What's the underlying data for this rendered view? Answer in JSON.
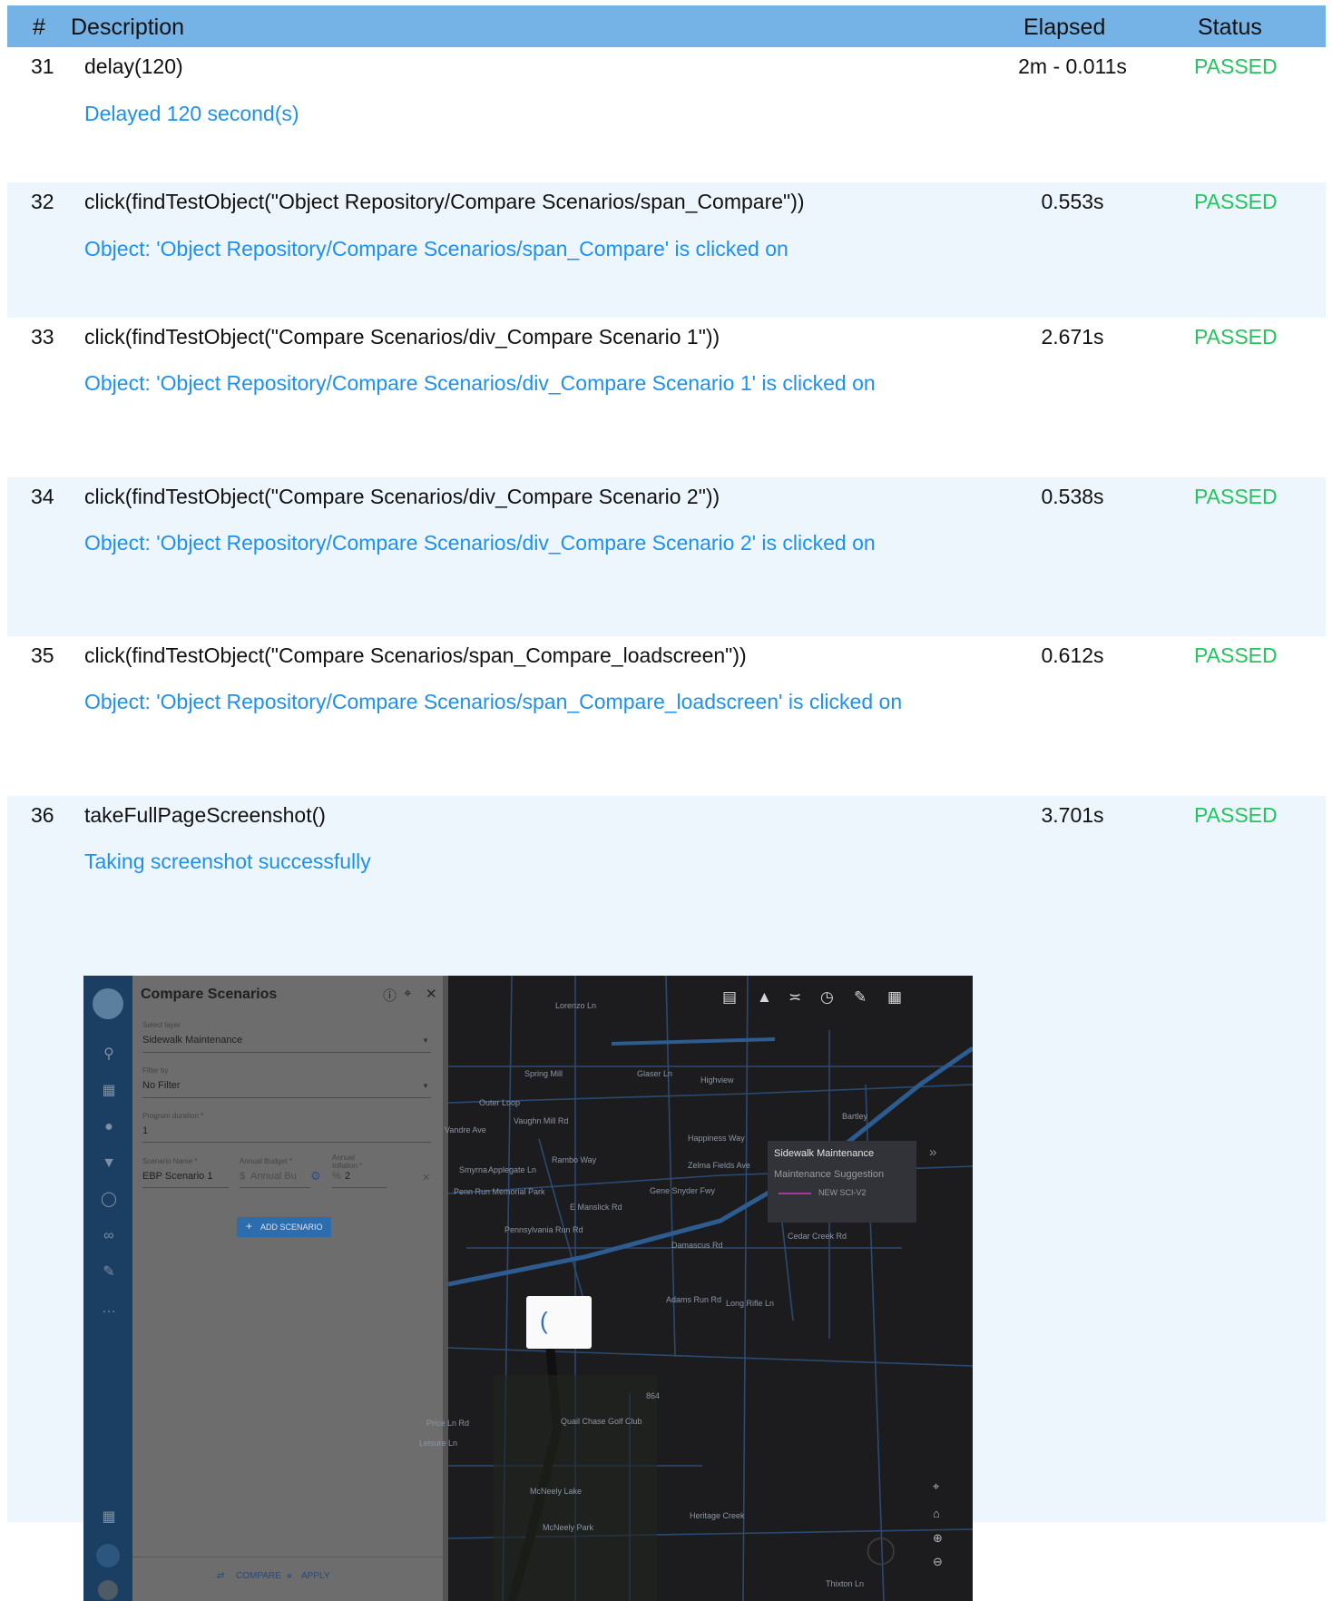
{
  "table": {
    "headers": {
      "num": "#",
      "description": "Description",
      "elapsed": "Elapsed",
      "status": "Status"
    },
    "rows": [
      {
        "num": "31",
        "description": "delay(120)",
        "elapsed": "2m - 0.011s",
        "status": "PASSED",
        "message": "Delayed 120 second(s)"
      },
      {
        "num": "32",
        "description": "click(findTestObject(\"Object Repository/Compare Scenarios/span_Compare\"))",
        "elapsed": "0.553s",
        "status": "PASSED",
        "message": "Object: 'Object Repository/Compare Scenarios/span_Compare' is clicked on"
      },
      {
        "num": "33",
        "description": "click(findTestObject(\"Compare Scenarios/div_Compare Scenario 1\"))",
        "elapsed": "2.671s",
        "status": "PASSED",
        "message": "Object: 'Object Repository/Compare Scenarios/div_Compare Scenario 1' is clicked on"
      },
      {
        "num": "34",
        "description": "click(findTestObject(\"Compare Scenarios/div_Compare Scenario 2\"))",
        "elapsed": "0.538s",
        "status": "PASSED",
        "message": "Object: 'Object Repository/Compare Scenarios/div_Compare Scenario 2' is clicked on"
      },
      {
        "num": "35",
        "description": "click(findTestObject(\"Compare Scenarios/span_Compare_loadscreen\"))",
        "elapsed": "0.612s",
        "status": "PASSED",
        "message": "Object: 'Object Repository/Compare Scenarios/span_Compare_loadscreen' is clicked on"
      },
      {
        "num": "36",
        "description": "takeFullPageScreenshot()",
        "elapsed": "3.701s",
        "status": "PASSED",
        "message": "Taking screenshot successfully"
      }
    ]
  },
  "screenshot": {
    "panel": {
      "title": "Compare Scenarios",
      "select_layer_label": "Select layer",
      "select_layer_value": "Sidewalk Maintenance",
      "filter_label": "Filter by",
      "filter_value": "No Filter",
      "duration_label": "Program duration *",
      "duration_value": "1",
      "scenario_name_label": "Scenario Name *",
      "scenario_name_value": "EBP Scenario 1",
      "budget_label": "Annual Budget *",
      "budget_prefix": "$",
      "budget_placeholder": "Annual Bu",
      "inflation_label_1": "Annual",
      "inflation_label_2": "Inflation *",
      "inflation_prefix": "%",
      "inflation_value": "2",
      "add_scenario": "ADD SCENARIO",
      "compare": "COMPARE",
      "apply": "APPLY"
    },
    "legend": {
      "title": "Sidewalk Maintenance",
      "subtitle": "Maintenance Suggestion",
      "item": "NEW SCI-V2"
    },
    "map_labels": [
      "Outer Loop",
      "Spring Mill",
      "Lorenzo Ln",
      "Glaser Ln",
      "Highview",
      "Vandre Ave",
      "Smyrna",
      "Applegate Ln",
      "Rambo Way",
      "Happiness Way",
      "Zelma Fields Ave",
      "E Manslick Rd",
      "Vaughn Mill Rd",
      "Penn Run Memorial Park",
      "Gene Snyder Fwy",
      "Damascus Rd",
      "Cedar Creek Rd",
      "Adams Run Rd",
      "Long Rifle Ln",
      "Pennsylvania Run Rd",
      "Price Ln Rd",
      "Leisure Ln",
      "Quail Chase Golf Club",
      "McNeely Lake",
      "McNeely Park",
      "Heritage Creek",
      "Thixton Ln",
      "Bartley",
      "864"
    ],
    "colors": {
      "rail": "#1b3f63",
      "panel": "#6d6d6e",
      "map": "#1c1c1f",
      "accent": "#2c6db0",
      "route": "#a23b97"
    }
  }
}
